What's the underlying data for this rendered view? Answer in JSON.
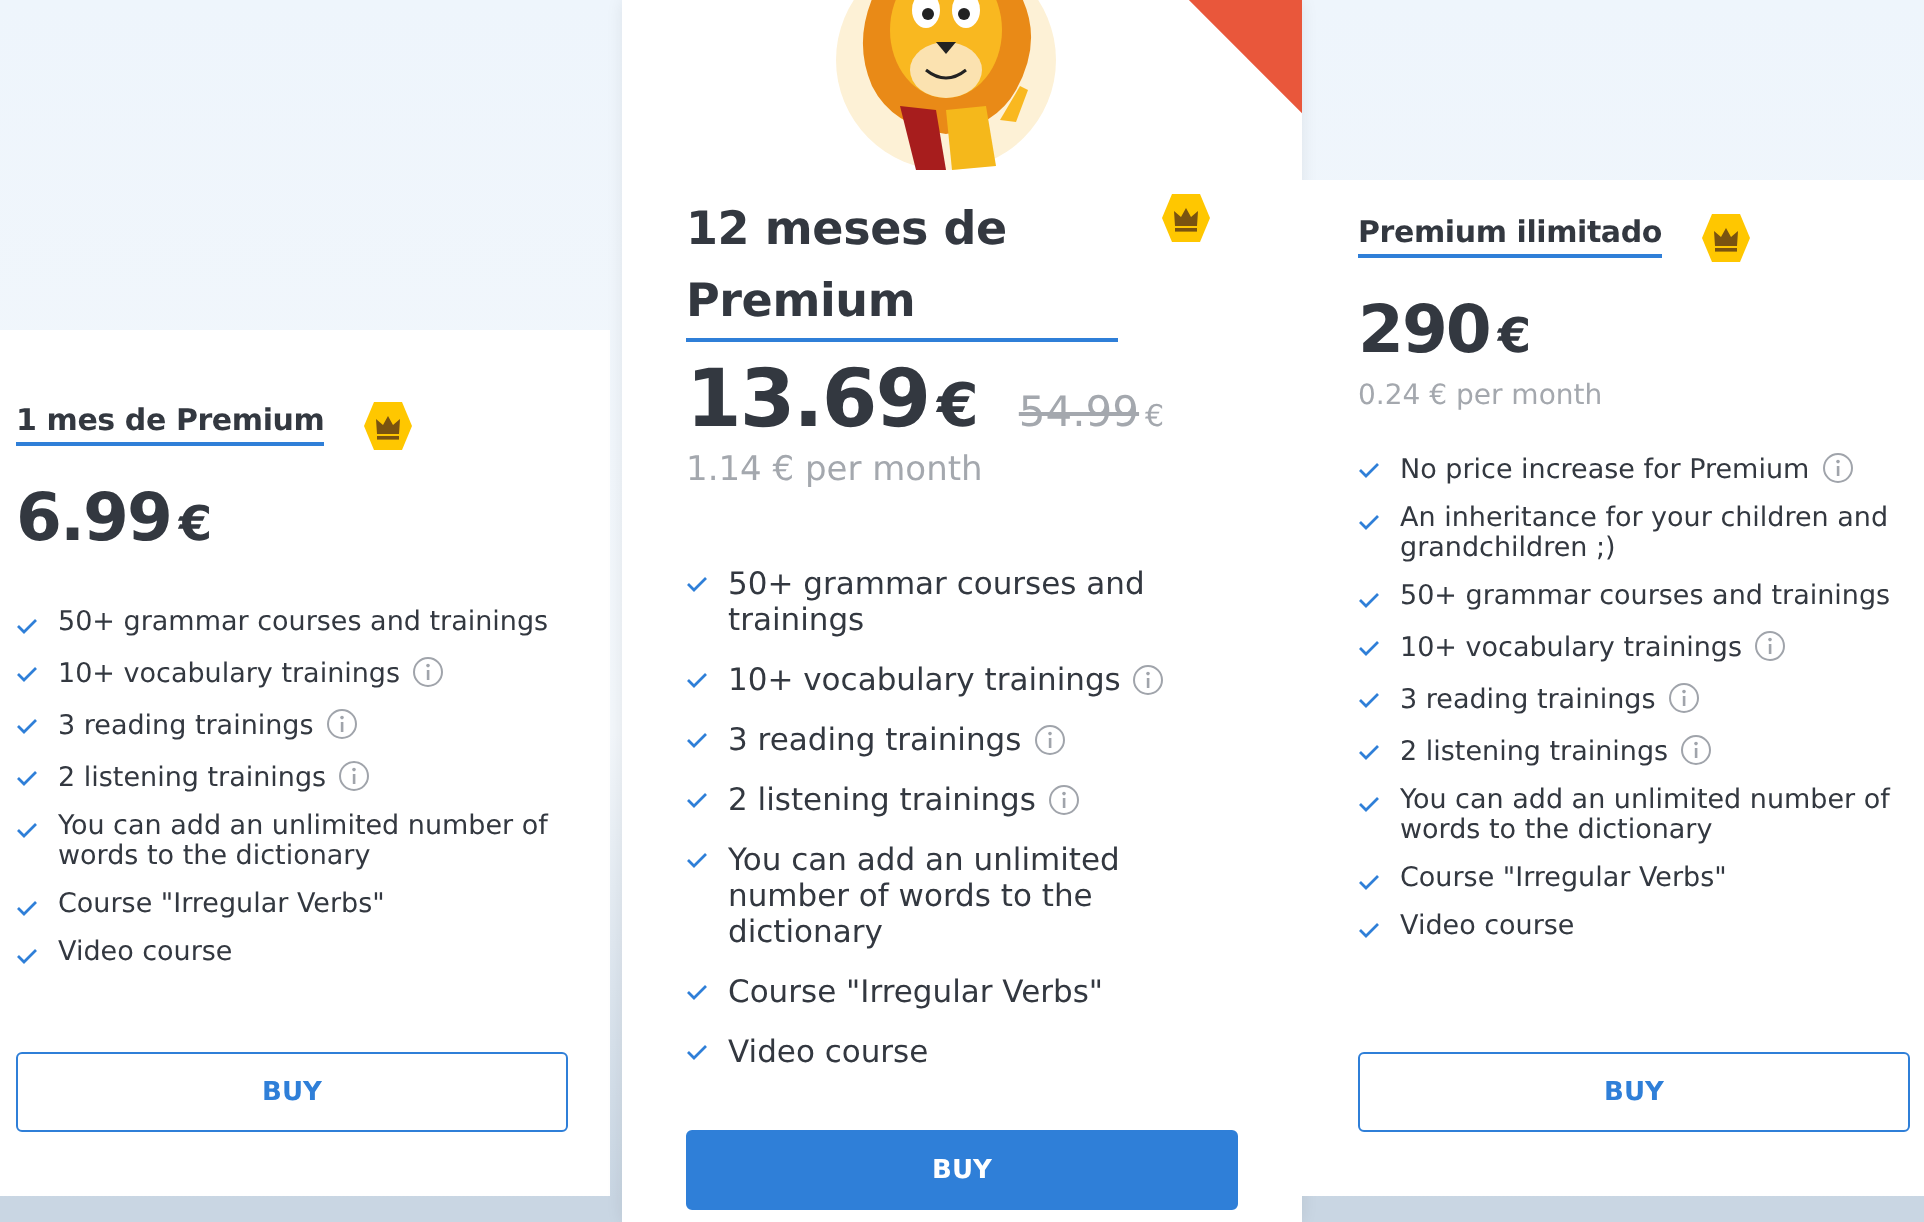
{
  "plans": [
    {
      "title": "1 mes de Premium",
      "price": "6.99",
      "currency": "€",
      "featured": false,
      "features": [
        {
          "text": "50+ grammar courses and trainings",
          "info": false
        },
        {
          "text": "10+ vocabulary trainings",
          "info": true
        },
        {
          "text": "3 reading trainings",
          "info": true
        },
        {
          "text": "2 listening trainings",
          "info": true
        },
        {
          "text": "You can add an unlimited number of words to the dictionary",
          "info": false
        },
        {
          "text": "Course \"Irregular Verbs\"",
          "info": false
        },
        {
          "text": "Video course",
          "info": false
        }
      ],
      "button": "BUY"
    },
    {
      "title": "12 meses de Premium",
      "price": "13.69",
      "currency": "€",
      "old_price": "54.99",
      "old_currency": "€",
      "per_month": "1.14 € per month",
      "featured": true,
      "features": [
        {
          "text": "50+ grammar courses and trainings",
          "info": false
        },
        {
          "text": "10+ vocabulary trainings",
          "info": true
        },
        {
          "text": "3 reading trainings",
          "info": true
        },
        {
          "text": "2 listening trainings",
          "info": true
        },
        {
          "text": "You can add an unlimited number of words to the dictionary",
          "info": false
        },
        {
          "text": "Course \"Irregular Verbs\"",
          "info": false
        },
        {
          "text": "Video course",
          "info": false
        }
      ],
      "button": "BUY"
    },
    {
      "title": "Premium ilimitado",
      "price": "290",
      "currency": "€",
      "per_month": "0.24 € per month",
      "featured": false,
      "features": [
        {
          "text": "No price increase for Premium",
          "info": true
        },
        {
          "text": "An inheritance for your children and grandchildren ;)",
          "info": false
        },
        {
          "text": "50+ grammar courses and trainings",
          "info": false
        },
        {
          "text": "10+ vocabulary trainings",
          "info": true
        },
        {
          "text": "3 reading trainings",
          "info": true
        },
        {
          "text": "2 listening trainings",
          "info": true
        },
        {
          "text": "You can add an unlimited number of words to the dictionary",
          "info": false
        },
        {
          "text": "Course \"Irregular Verbs\"",
          "info": false
        },
        {
          "text": "Video course",
          "info": false
        }
      ],
      "button": "BUY"
    }
  ]
}
